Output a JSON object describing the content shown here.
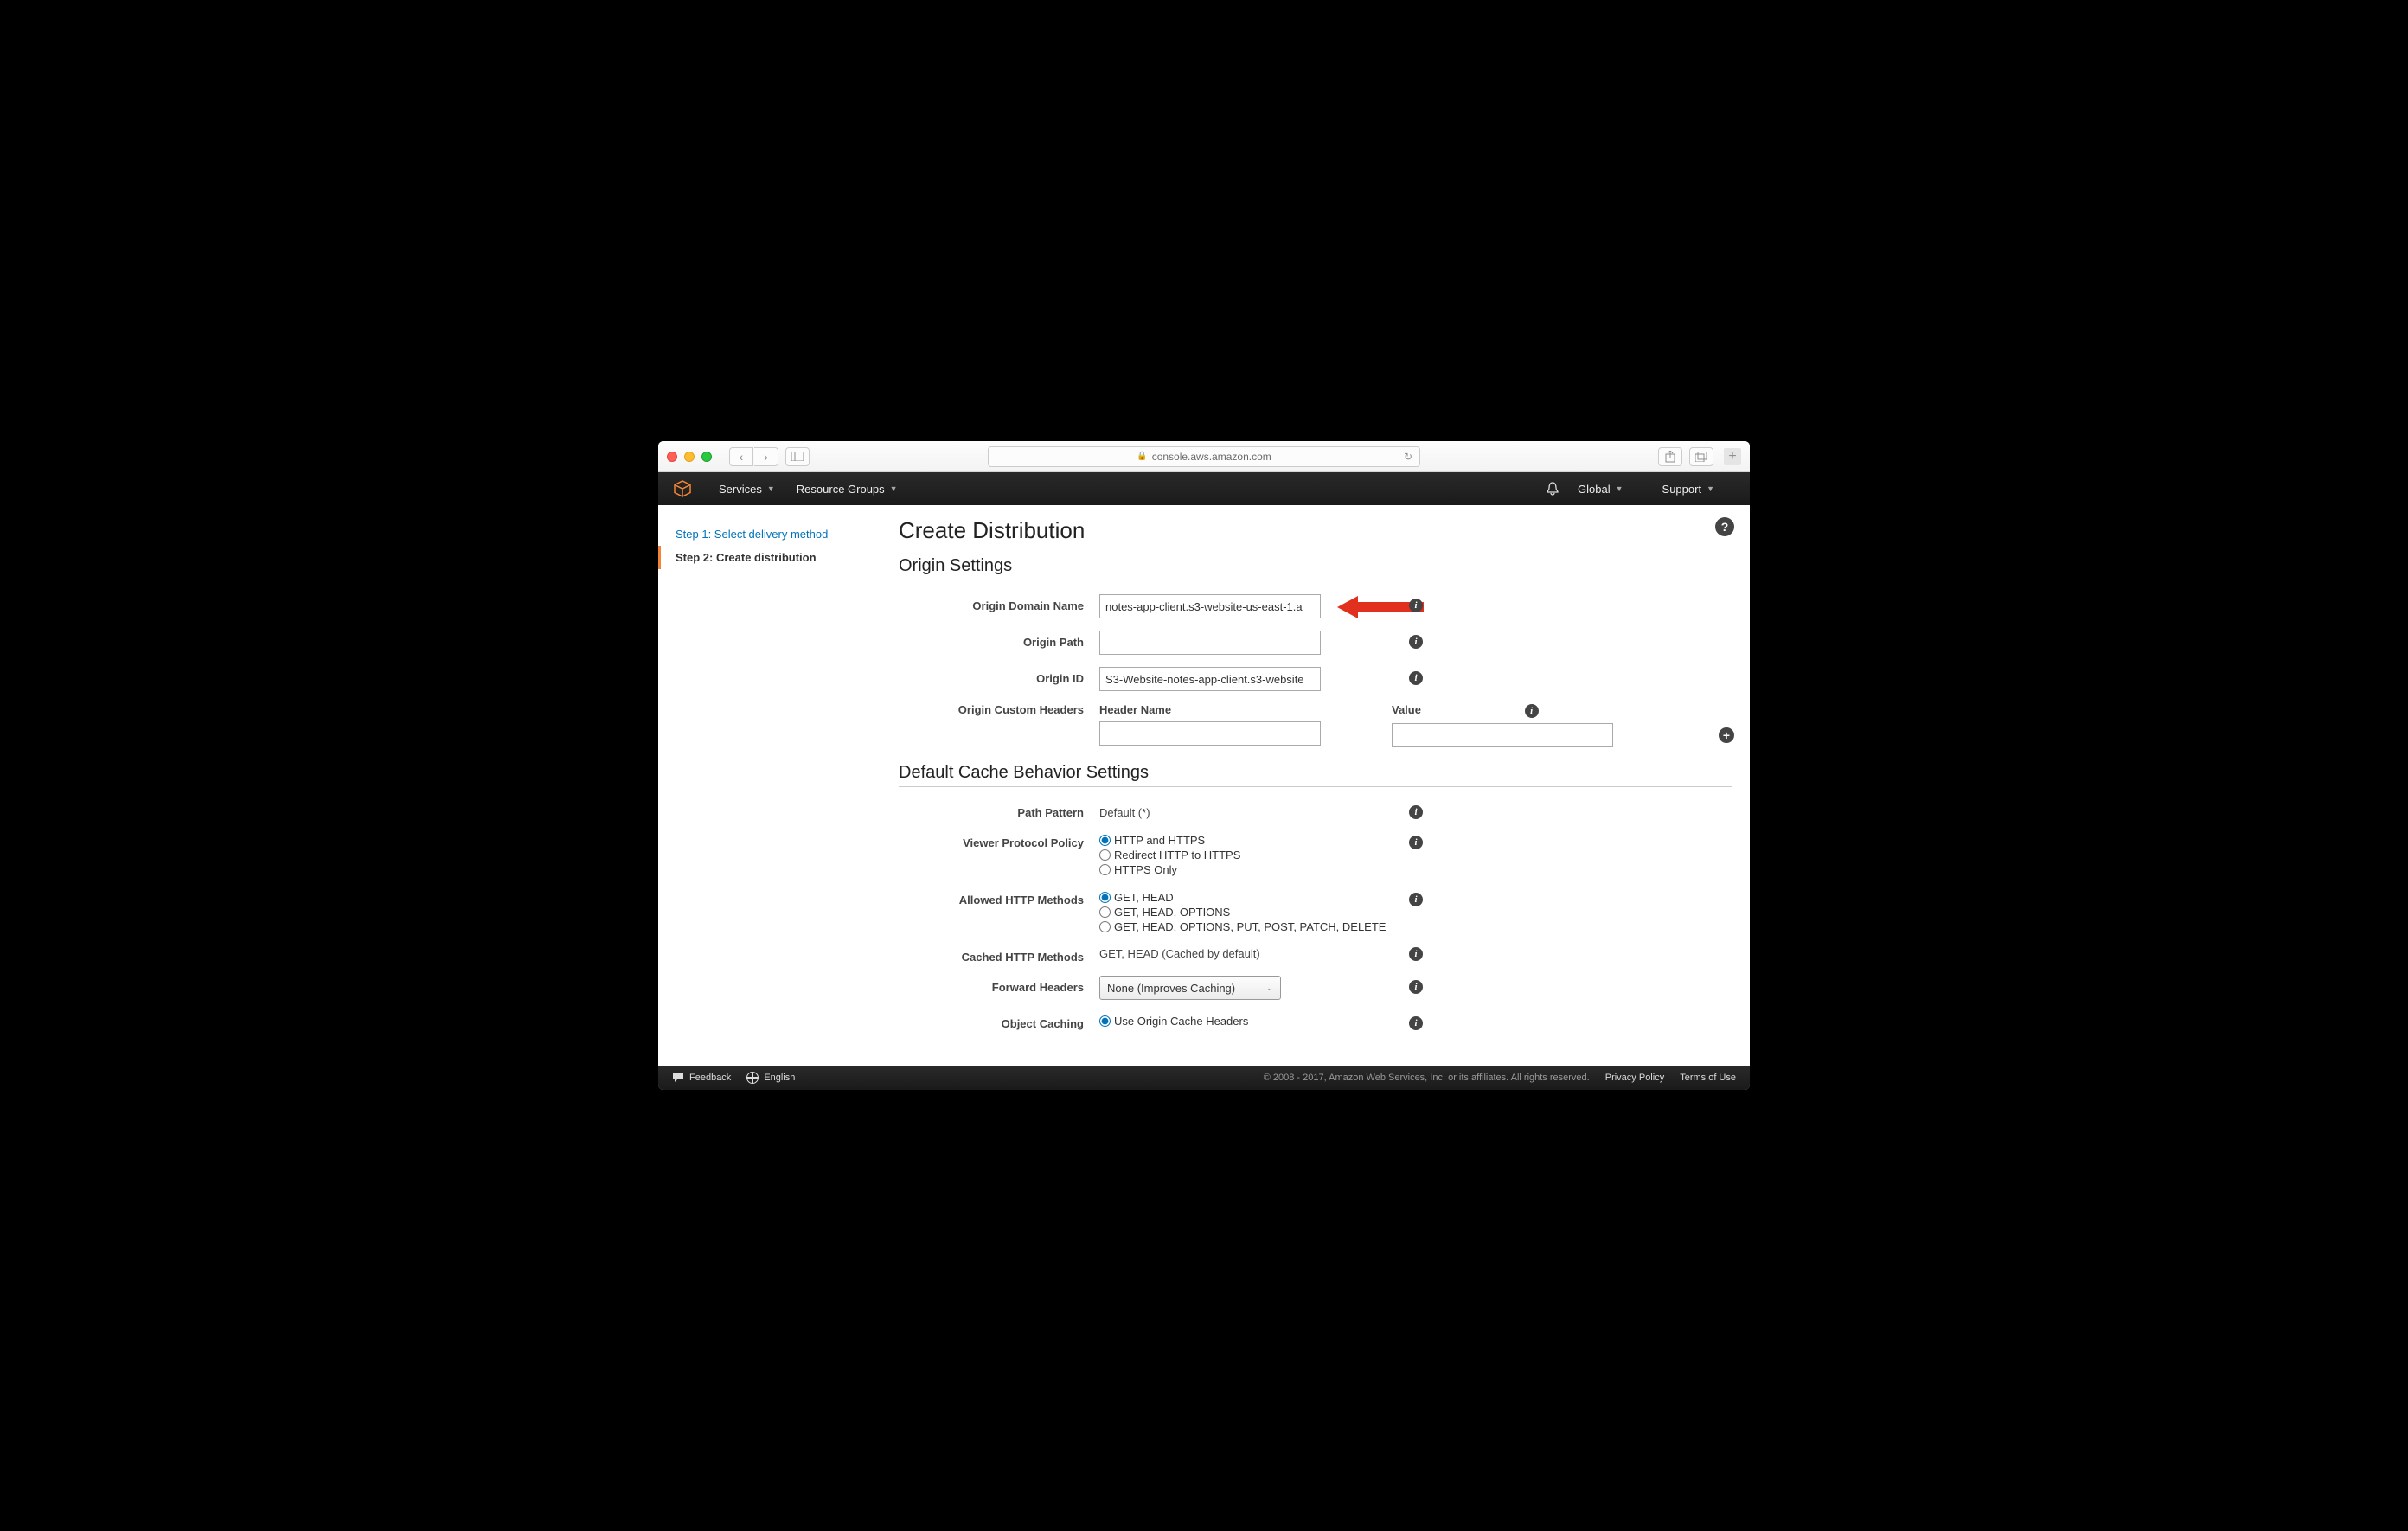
{
  "browser": {
    "url": "console.aws.amazon.com"
  },
  "topbar": {
    "services": "Services",
    "resource_groups": "Resource Groups",
    "global": "Global",
    "support": "Support"
  },
  "sidebar": {
    "step1": "Step 1: Select delivery method",
    "step2": "Step 2: Create distribution"
  },
  "page_title": "Create Distribution",
  "section_origin": "Origin Settings",
  "section_cache": "Default Cache Behavior Settings",
  "origin": {
    "domain_label": "Origin Domain Name",
    "domain_value": "notes-app-client.s3-website-us-east-1.a",
    "path_label": "Origin Path",
    "path_value": "",
    "id_label": "Origin ID",
    "id_value": "S3-Website-notes-app-client.s3-website",
    "custom_headers_label": "Origin Custom Headers",
    "header_name_label": "Header Name",
    "value_label": "Value"
  },
  "cache": {
    "path_pattern_label": "Path Pattern",
    "path_pattern_value": "Default (*)",
    "viewer_protocol_label": "Viewer Protocol Policy",
    "viewer_options": [
      "HTTP and HTTPS",
      "Redirect HTTP to HTTPS",
      "HTTPS Only"
    ],
    "allowed_methods_label": "Allowed HTTP Methods",
    "allowed_options": [
      "GET, HEAD",
      "GET, HEAD, OPTIONS",
      "GET, HEAD, OPTIONS, PUT, POST, PATCH, DELETE"
    ],
    "cached_methods_label": "Cached HTTP Methods",
    "cached_methods_value": "GET, HEAD (Cached by default)",
    "forward_headers_label": "Forward Headers",
    "forward_headers_value": "None (Improves Caching)",
    "object_caching_label": "Object Caching",
    "object_caching_option": "Use Origin Cache Headers"
  },
  "footer": {
    "feedback": "Feedback",
    "language": "English",
    "copyright": "© 2008 - 2017, Amazon Web Services, Inc. or its affiliates. All rights reserved.",
    "privacy": "Privacy Policy",
    "terms": "Terms of Use"
  }
}
